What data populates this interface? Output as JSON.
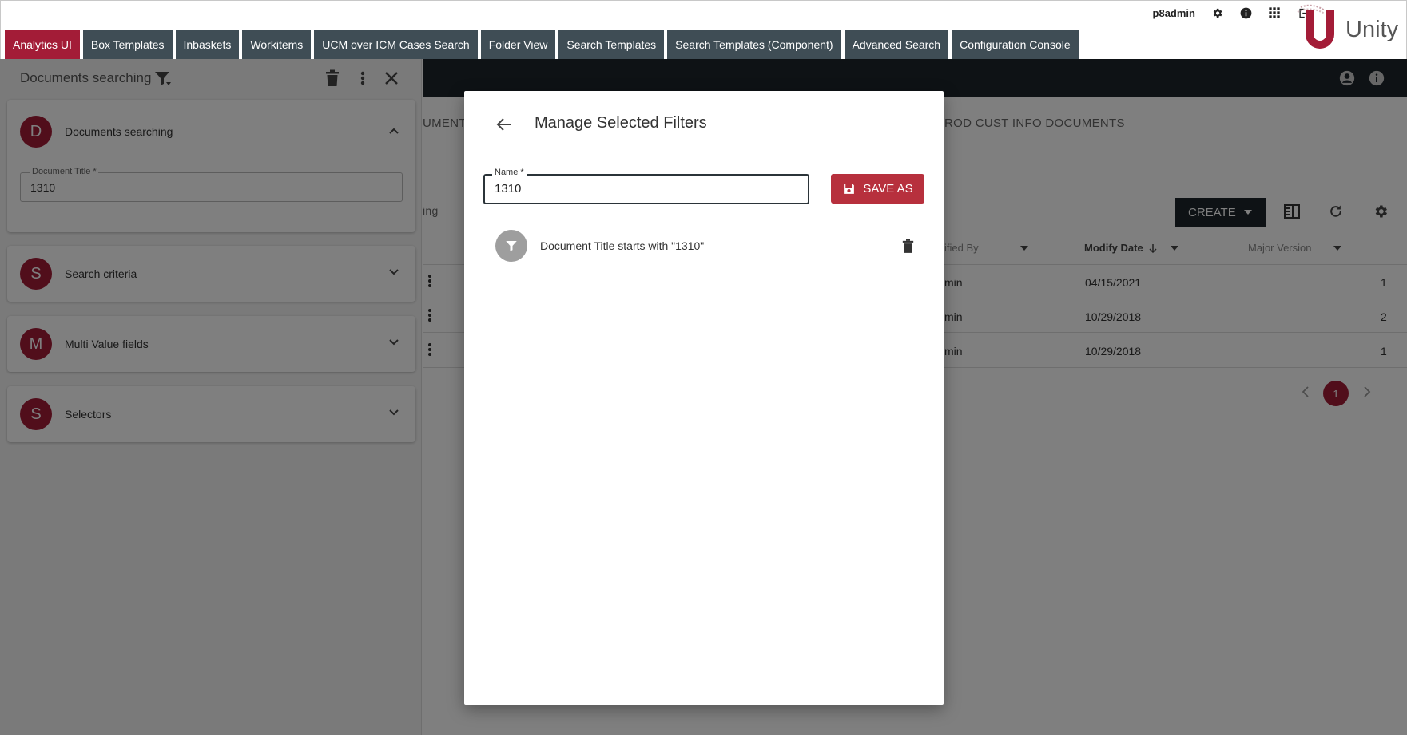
{
  "topbar": {
    "tabs": [
      {
        "label": "Analytics UI",
        "active": true
      },
      {
        "label": "Box Templates"
      },
      {
        "label": "Inbaskets"
      },
      {
        "label": "Workitems"
      },
      {
        "label": "UCM over ICM Cases Search"
      },
      {
        "label": "Folder View"
      },
      {
        "label": "Search Templates"
      },
      {
        "label": "Search Templates (Component)"
      },
      {
        "label": "Advanced Search"
      },
      {
        "label": "Configuration Console"
      }
    ],
    "username": "p8admin",
    "icons": [
      "gear-icon",
      "info-icon",
      "apps-grid-icon",
      "logout-icon"
    ],
    "logo_text": "Unity",
    "accent_color": "#a31c37",
    "tab_color": "#3f4d55"
  },
  "left_panel": {
    "title": "Documents searching",
    "header_icons": [
      "filter-icon",
      "delete-icon",
      "more-vert-icon",
      "close-icon"
    ],
    "sections": [
      {
        "avatar": "D",
        "label": "Documents searching",
        "expanded": true,
        "field": {
          "label": "Document Title *",
          "value": "1310"
        }
      },
      {
        "avatar": "S",
        "label": "Search criteria",
        "expanded": false
      },
      {
        "avatar": "M",
        "label": "Multi Value fields",
        "expanded": false
      },
      {
        "avatar": "S",
        "label": "Selectors",
        "expanded": false
      }
    ]
  },
  "background": {
    "crumb_left": "UMENT",
    "crumb_right": "ROD CUST INFO DOCUMENTS",
    "partial_text": "ing",
    "create_label": "CREATE",
    "columns": {
      "modified_by": "ified By",
      "modify_date": "Modify Date",
      "major_version": "Major Version"
    },
    "rows": [
      {
        "modified_by": "min",
        "modify_date": "04/15/2021",
        "major_version": "1"
      },
      {
        "modified_by": "min",
        "modify_date": "10/29/2018",
        "major_version": "2"
      },
      {
        "modified_by": "min",
        "modify_date": "10/29/2018",
        "major_version": "1"
      }
    ],
    "current_page": "1"
  },
  "modal": {
    "title": "Manage Selected Filters",
    "name_field": {
      "label": "Name *",
      "value": "1310"
    },
    "save_as_label": "SAVE AS",
    "filters": [
      {
        "text": "Document Title starts with \"1310\""
      }
    ]
  }
}
